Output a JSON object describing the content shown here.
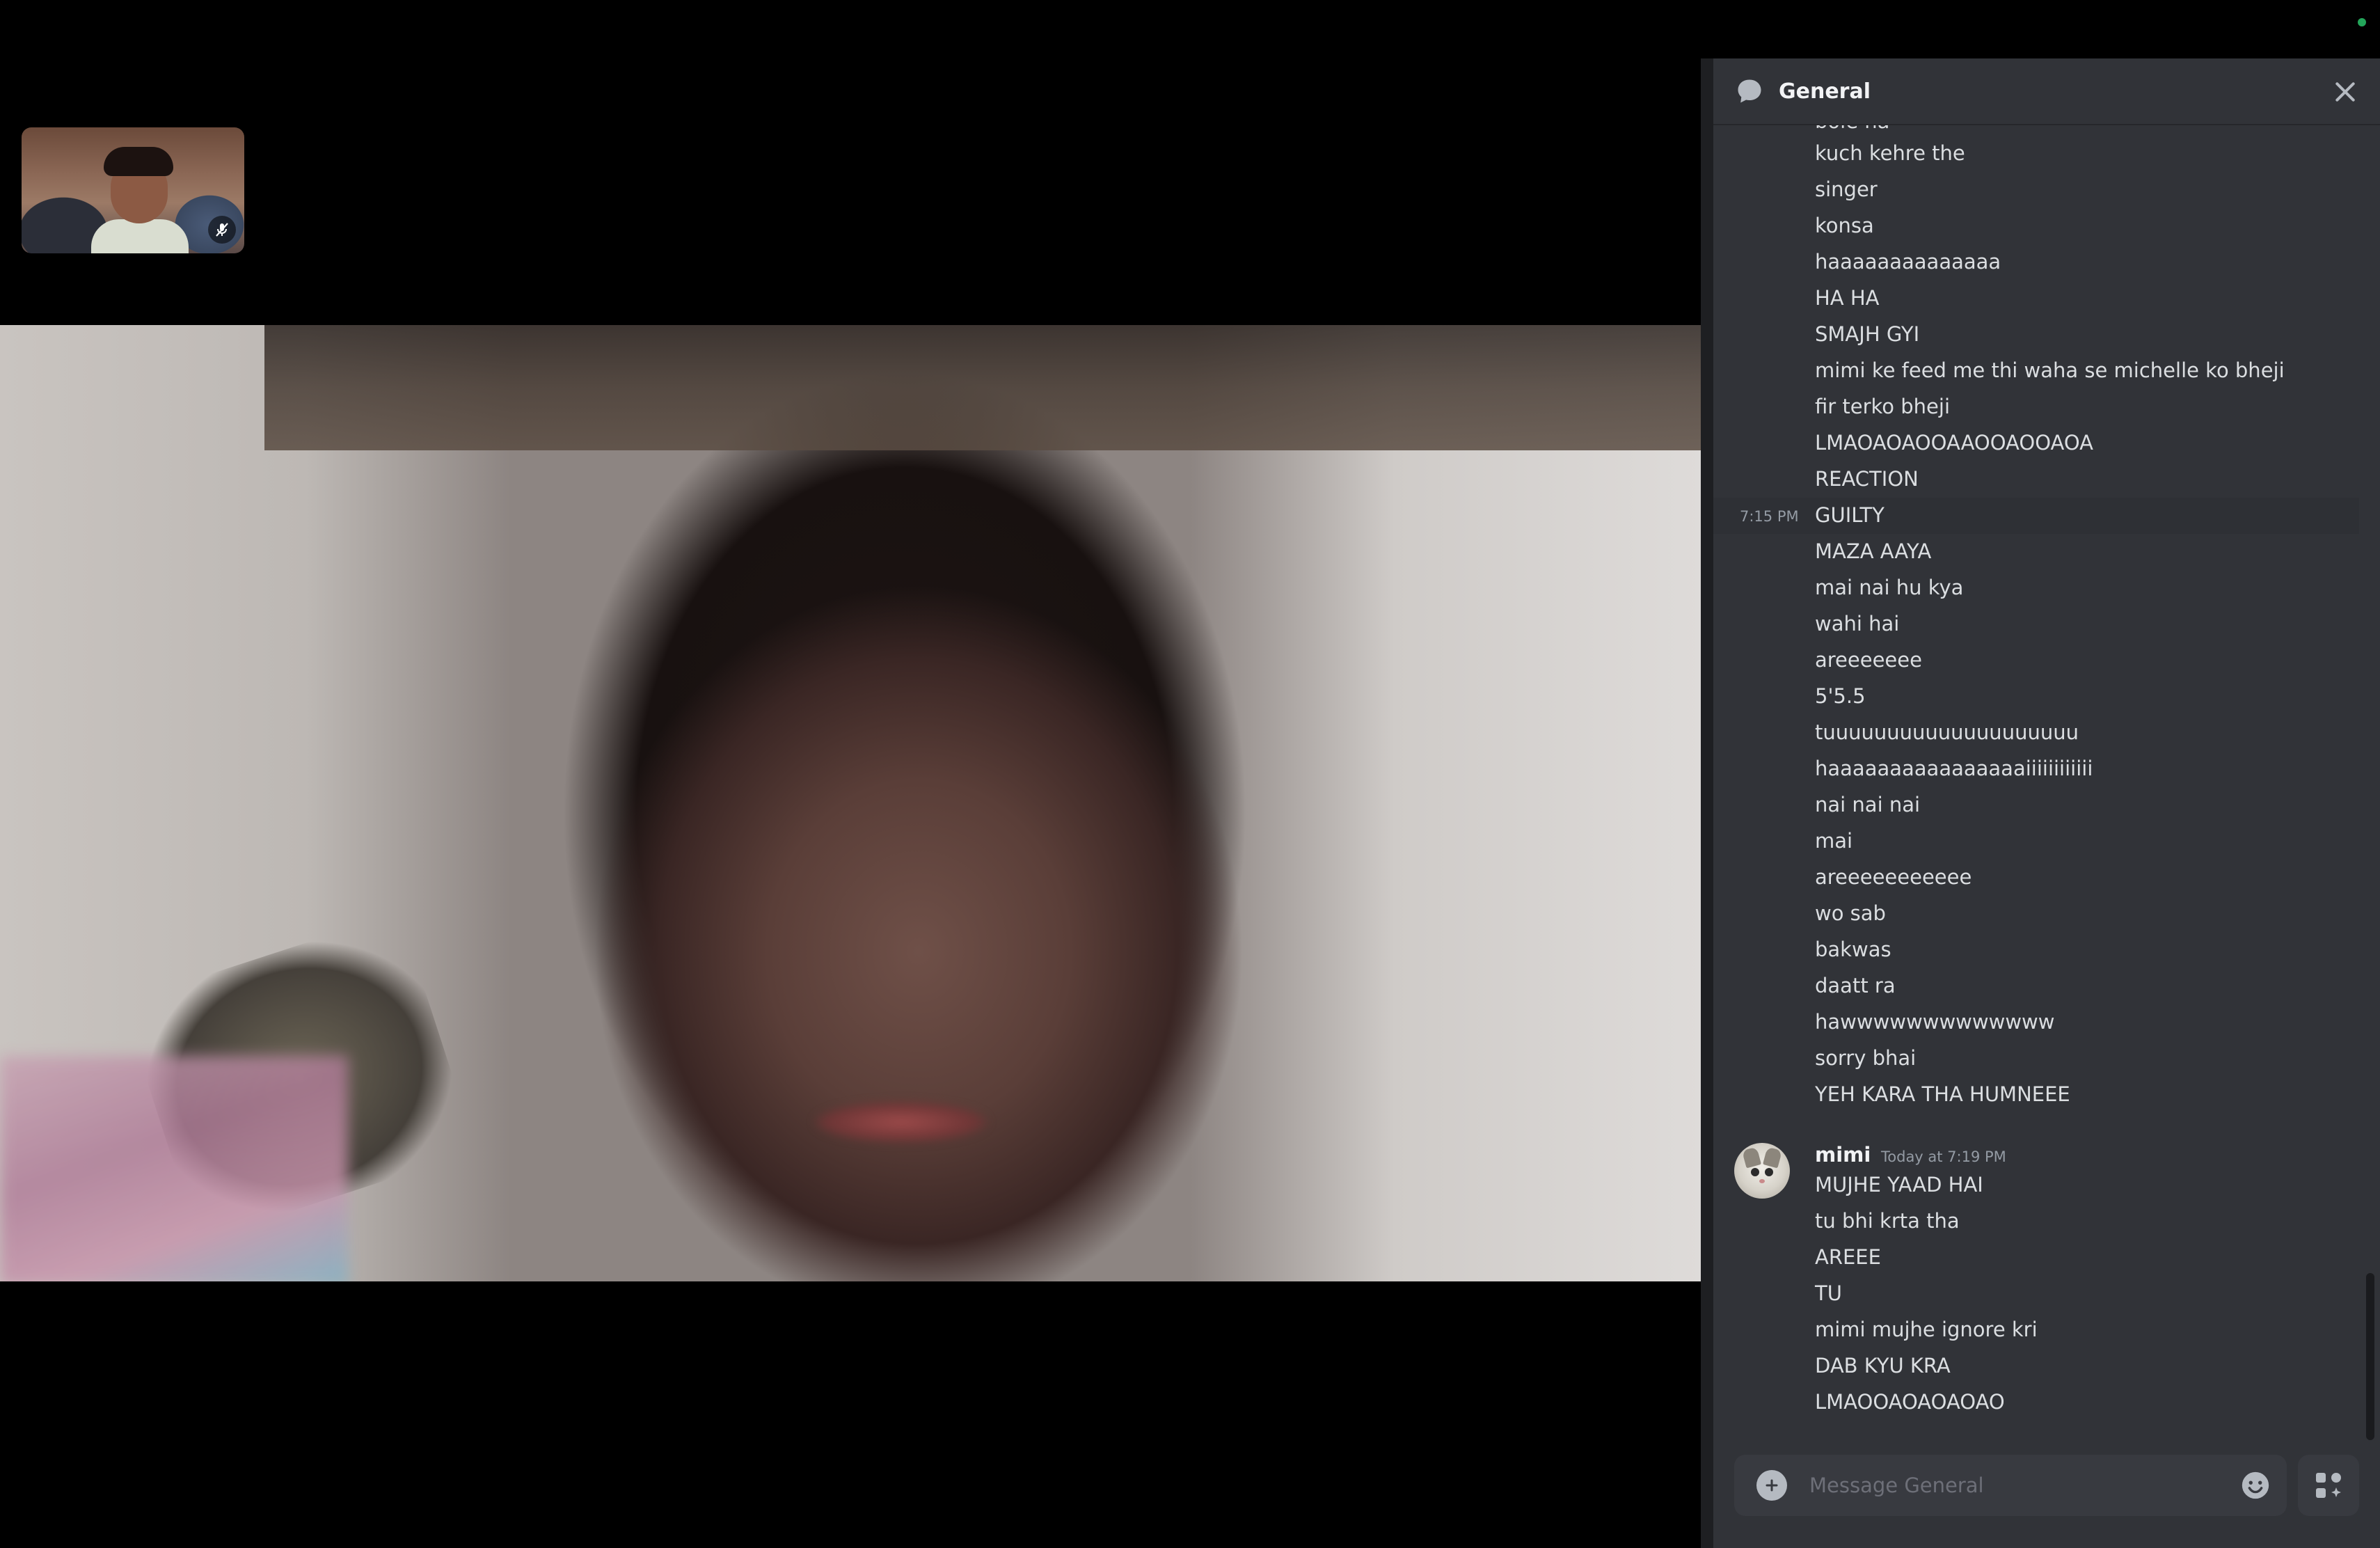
{
  "chat": {
    "channel_name": "General",
    "partial_top_line": "bole na",
    "lines_before": [
      "kuch kehre the",
      "singer",
      "konsa",
      "haaaaaaaaaaaaaa",
      "HA HA",
      "SMAJH GYI",
      "mimi ke feed me thi waha se michelle ko bheji",
      "fir terko bheji",
      "LMAOAOAOOAAOOAOOAOA",
      "REACTION"
    ],
    "hover_timestamp": "7:15 PM",
    "hover_line": "GUILTY",
    "lines_after": [
      "MAZA AAYA",
      "mai nai hu kya",
      "wahi hai",
      "areeeeeee",
      "5'5.5",
      "tuuuuuuuuuuuuuuuuuuuu",
      "haaaaaaaaaaaaaaaaiiiiiiiiiiii",
      "nai nai nai",
      "mai",
      "areeeeeeeeeee",
      "wo sab",
      "bakwas",
      "daatt ra",
      "hawwwwwwwwwwwww",
      "sorry bhai",
      "YEH KARA THA HUMNEEE"
    ],
    "mimi_group": {
      "username": "mimi",
      "time": "Today at 7:19 PM",
      "lines": [
        "MUJHE YAAD HAI",
        "tu bhi krta tha",
        "AREEE",
        "TU",
        "mimi mujhe ignore kri",
        "DAB KYU KRA",
        "LMAOOAOAOAOAO"
      ]
    },
    "composer_placeholder": "Message General"
  },
  "icons": {
    "thread": "chat-bubble-icon",
    "close": "close-icon",
    "mute": "mic-muted-icon",
    "add": "plus-icon",
    "emoji": "emoji-icon",
    "apps": "apps-icon"
  },
  "colors": {
    "chat_bg": "#313338",
    "text": "#dbdee1",
    "muted_text": "#949ba4",
    "online": "#23a55a"
  }
}
